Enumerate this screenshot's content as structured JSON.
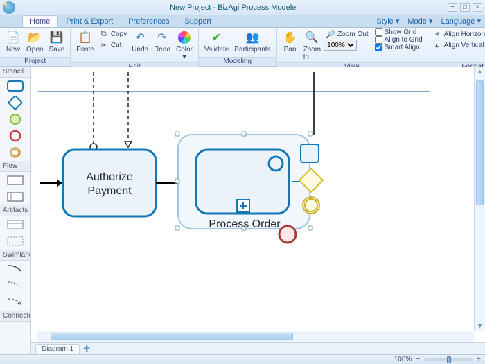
{
  "title": "New Project - BizAgi Process Modeler",
  "tabs": {
    "home": "Home",
    "print": "Print & Export",
    "prefs": "Preferences",
    "support": "Support"
  },
  "styleMenus": {
    "style": "Style",
    "mode": "Mode",
    "lang": "Language"
  },
  "ribbon": {
    "project_label": "Project",
    "new": "New",
    "open": "Open",
    "save": "Save",
    "edit_label": "Edit",
    "paste": "Paste",
    "copy": "Copy",
    "cut": "Cut",
    "undo": "Undo",
    "redo": "Redo",
    "color": "Color",
    "modeling_label": "Modeling",
    "validate": "Validate",
    "participants": "Participants",
    "view_label": "View",
    "pan": "Pan",
    "zoomin": "Zoom In",
    "zoomout": "Zoom Out",
    "zoom_value": "100%",
    "showgrid": "Show Grid",
    "aligngrid": "Align to Grid",
    "smartalign": "Smart Align",
    "format_label": "Format",
    "alignh": "Align Horizontal",
    "alignv": "Align Vertical",
    "align": "Align"
  },
  "stencil": {
    "head": "Stencil",
    "flow": "Flow",
    "artifacts": "Artifacts",
    "swimlanes": "Swimlanes",
    "connectors": "Connectors"
  },
  "nodes": {
    "authorize": "Authorize Payment",
    "process": "Process Order"
  },
  "diagram_tab": "Diagram 1",
  "status_zoom": "100%"
}
